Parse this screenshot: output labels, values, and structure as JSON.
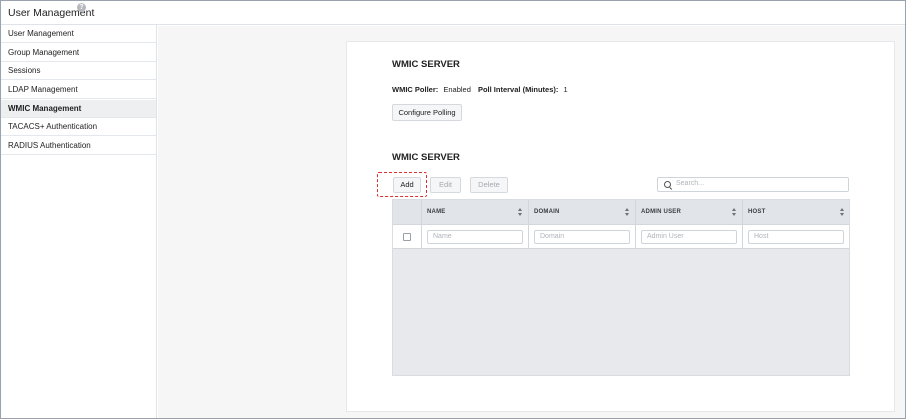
{
  "app": {
    "title": "User Management",
    "help": "?"
  },
  "sidebar": {
    "items": [
      {
        "label": "User Management"
      },
      {
        "label": "Group Management"
      },
      {
        "label": "Sessions"
      },
      {
        "label": "LDAP Management"
      },
      {
        "label": "WMIC Management"
      },
      {
        "label": "TACACS+ Authentication"
      },
      {
        "label": "RADIUS Authentication"
      }
    ],
    "active": "WMIC Management"
  },
  "poller_section": {
    "title": "WMIC SERVER",
    "poller_label": "WMIC Poller:",
    "poller_value": "Enabled",
    "interval_label": "Poll Interval (Minutes):",
    "interval_value": "1",
    "configure_button": "Configure Polling"
  },
  "server_section": {
    "title": "WMIC SERVER",
    "toolbar": {
      "add": "Add",
      "edit": "Edit",
      "delete": "Delete"
    },
    "search": {
      "placeholder": "Search..."
    },
    "columns": [
      {
        "label": "NAME",
        "filter_placeholder": "Name"
      },
      {
        "label": "DOMAIN",
        "filter_placeholder": "Domain"
      },
      {
        "label": "ADMIN USER",
        "filter_placeholder": "Admin User"
      },
      {
        "label": "HOST",
        "filter_placeholder": "Host"
      }
    ],
    "rows": []
  },
  "colors": {
    "highlight": "#d9302f",
    "grid_header": "#e1e4e8",
    "active_nav": "#eeeff1"
  }
}
